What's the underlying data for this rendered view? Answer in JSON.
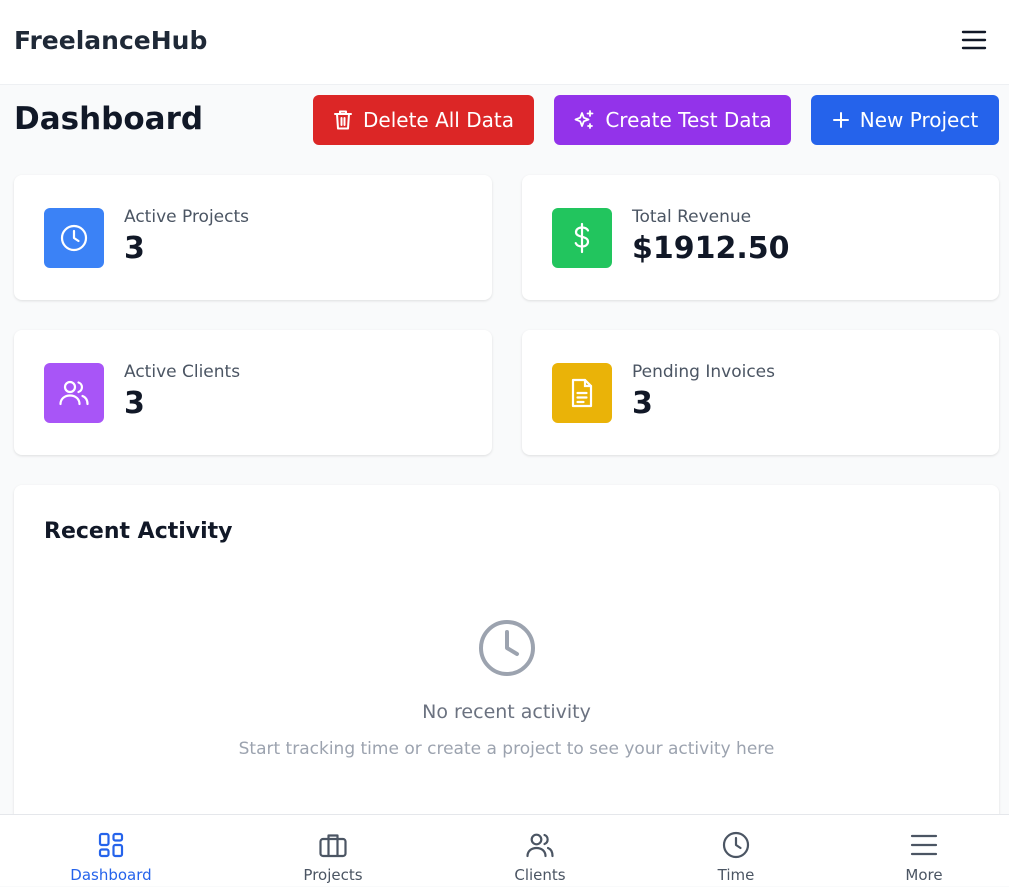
{
  "app": {
    "title": "FreelanceHub"
  },
  "header": {
    "menu_icon": "menu-icon"
  },
  "page": {
    "title": "Dashboard"
  },
  "actions": {
    "delete_label": "Delete All Data",
    "test_label": "Create Test Data",
    "new_label": "New Project"
  },
  "stats": [
    {
      "label": "Active Projects",
      "value": "3",
      "icon": "clock-icon",
      "color": "#3b82f6"
    },
    {
      "label": "Total Revenue",
      "value": "$1912.50",
      "icon": "dollar-icon",
      "color": "#22c55e"
    },
    {
      "label": "Active Clients",
      "value": "3",
      "icon": "users-icon",
      "color": "#a855f7"
    },
    {
      "label": "Pending Invoices",
      "value": "3",
      "icon": "document-icon",
      "color": "#eab308"
    }
  ],
  "activity": {
    "title": "Recent Activity",
    "empty_title": "No recent activity",
    "empty_subtitle": "Start tracking time or create a project to see your activity here"
  },
  "nav": {
    "items": [
      {
        "label": "Dashboard",
        "icon": "dashboard-icon",
        "active": true
      },
      {
        "label": "Projects",
        "icon": "briefcase-icon",
        "active": false
      },
      {
        "label": "Clients",
        "icon": "users-icon",
        "active": false
      },
      {
        "label": "Time",
        "icon": "clock-icon",
        "active": false
      },
      {
        "label": "More",
        "icon": "menu-icon",
        "active": false
      }
    ]
  },
  "colors": {
    "delete": "#dc2626",
    "test": "#9333ea",
    "primary": "#2563eb"
  }
}
